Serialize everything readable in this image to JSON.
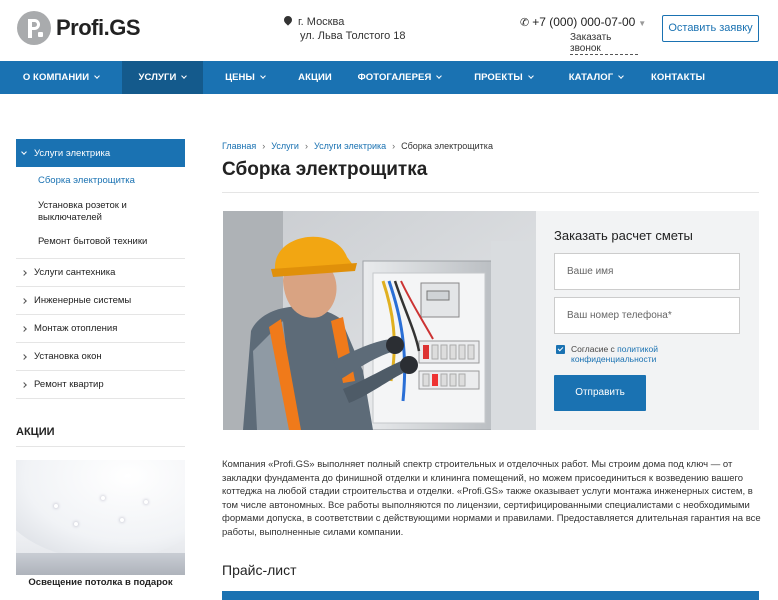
{
  "header": {
    "logo_text": "Profi.GS",
    "address_city": "г. Москва",
    "address_street": "ул. Льва Толстого 18",
    "phone": "+7 (000) 000-07-00",
    "callback_label": "Заказать звонок",
    "cta_label": "Оставить заявку"
  },
  "nav": {
    "items": [
      {
        "label": "О КОМПАНИИ",
        "has_dropdown": true
      },
      {
        "label": "УСЛУГИ",
        "has_dropdown": true,
        "active": true
      },
      {
        "label": "ЦЕНЫ",
        "has_dropdown": true
      },
      {
        "label": "АКЦИИ",
        "has_dropdown": false
      },
      {
        "label": "ФОТОГАЛЕРЕЯ",
        "has_dropdown": true
      },
      {
        "label": "ПРОЕКТЫ",
        "has_dropdown": true
      },
      {
        "label": "КАТАЛОГ",
        "has_dropdown": true
      },
      {
        "label": "КОНТАКТЫ",
        "has_dropdown": false
      }
    ]
  },
  "sidebar": {
    "head": "Услуги электрика",
    "sub_items": [
      "Сборка электрощитка",
      "Установка розеток и выключателей",
      "Ремонт бытовой техники"
    ],
    "items": [
      "Услуги сантехника",
      "Инженерные системы",
      "Монтаж отопления",
      "Установка окон",
      "Ремонт квартир"
    ],
    "promo_title": "АКЦИИ",
    "promo_caption": "Освещение потолка в подарок"
  },
  "breadcrumb": {
    "items": [
      "Главная",
      "Услуги",
      "Услуги электрика"
    ],
    "current": "Сборка электрощитка"
  },
  "page_title": "Сборка электрощитка",
  "form": {
    "title": "Заказать расчет сметы",
    "name_placeholder": "Ваше имя",
    "phone_placeholder": "Ваш номер телефона*",
    "agree_prefix": "Согласие с ",
    "agree_link_1": "политикой",
    "agree_link_2": "конфиденциальности",
    "submit_label": "Отправить"
  },
  "description": "Компания «Profi.GS» выполняет полный спектр строительных и отделочных работ. Мы строим дома под ключ — от закладки фундамента до финишной отделки и клининга помещений, но можем присоединиться к возведению вашего коттеджа на любой стадии строительства и отделки. «Profi.GS» также оказывает услуги монтажа инженерных систем, в том числе автономных. Все работы выполняются по лицензии, сертифицированными специалистами с необходимыми формами допуска, в соответствии с действующими нормами и правилами. Предоставляется длительная гарантия на все работы, выполненные силами компании.",
  "price_title": "Прайс-лист",
  "colors": {
    "accent": "#1a72b2",
    "nav_active": "#145a8c",
    "form_bg": "#f2f3f4"
  }
}
